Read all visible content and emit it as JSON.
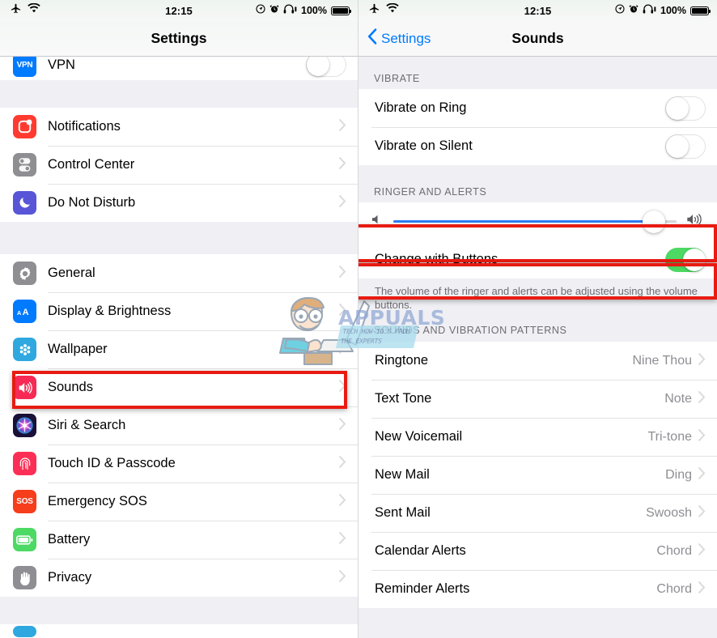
{
  "status_bar": {
    "airplane_icon": "airplane-icon",
    "wifi_icon": "wifi-icon",
    "time": "12:15",
    "location_icon": "location-icon",
    "alarm_icon": "alarm-icon",
    "headphones_icon": "headphones-icon",
    "battery_percent": "100%",
    "battery_icon": "battery-icon"
  },
  "left_screen": {
    "title": "Settings",
    "groups": [
      {
        "rows": [
          {
            "label": "VPN",
            "icon": "vpn-icon",
            "accessory": "toggle",
            "toggle_on": false,
            "icon_color": "#007aff"
          }
        ]
      },
      {
        "rows": [
          {
            "label": "Notifications",
            "icon": "notifications-icon",
            "accessory": "chevron",
            "icon_color": "#ff3b30"
          },
          {
            "label": "Control Center",
            "icon": "control-center-icon",
            "accessory": "chevron",
            "icon_color": "#8e8e93"
          },
          {
            "label": "Do Not Disturb",
            "icon": "do-not-disturb-icon",
            "accessory": "chevron",
            "icon_color": "#5856d6"
          }
        ]
      },
      {
        "rows": [
          {
            "label": "General",
            "icon": "gear-icon",
            "accessory": "chevron",
            "icon_color": "#8e8e93"
          },
          {
            "label": "Display & Brightness",
            "icon": "display-brightness-icon",
            "accessory": "chevron",
            "icon_color": "#007aff"
          },
          {
            "label": "Wallpaper",
            "icon": "wallpaper-icon",
            "accessory": "chevron",
            "icon_color": "#2fa8e0"
          },
          {
            "label": "Sounds",
            "icon": "sounds-icon",
            "accessory": "chevron",
            "icon_color": "#f62a54",
            "highlighted": true
          },
          {
            "label": "Siri & Search",
            "icon": "siri-icon",
            "accessory": "chevron",
            "icon_color": "#1b1038"
          },
          {
            "label": "Touch ID & Passcode",
            "icon": "touch-id-icon",
            "accessory": "chevron",
            "icon_color": "#fb2f55"
          },
          {
            "label": "Emergency SOS",
            "icon": "emergency-sos-icon",
            "accessory": "chevron",
            "icon_color": "#f63d1c"
          },
          {
            "label": "Battery",
            "icon": "battery-settings-icon",
            "accessory": "chevron",
            "icon_color": "#4cd964"
          },
          {
            "label": "Privacy",
            "icon": "privacy-icon",
            "accessory": "chevron",
            "icon_color": "#8e8e93"
          }
        ]
      }
    ]
  },
  "right_screen": {
    "back_label": "Settings",
    "title": "Sounds",
    "vibrate_header": "VIBRATE",
    "vibrate_rows": [
      {
        "label": "Vibrate on Ring",
        "toggle_on": false
      },
      {
        "label": "Vibrate on Silent",
        "toggle_on": false
      }
    ],
    "ringer_header": "RINGER AND ALERTS",
    "volume_slider": {
      "value": 92,
      "min_icon": "speaker-low-icon",
      "max_icon": "speaker-high-icon"
    },
    "change_with_buttons": {
      "label": "Change with Buttons",
      "toggle_on": true
    },
    "footer_text": "The volume of the ringer and alerts can be adjusted using the volume buttons.",
    "patterns_header": "SOUNDS AND VIBRATION PATTERNS",
    "pattern_rows": [
      {
        "label": "Ringtone",
        "value": "Nine Thou"
      },
      {
        "label": "Text Tone",
        "value": "Note"
      },
      {
        "label": "New Voicemail",
        "value": "Tri-tone"
      },
      {
        "label": "New Mail",
        "value": "Ding"
      },
      {
        "label": "Sent Mail",
        "value": "Swoosh"
      },
      {
        "label": "Calendar Alerts",
        "value": "Chord"
      },
      {
        "label": "Reminder Alerts",
        "value": "Chord"
      }
    ]
  },
  "watermark": {
    "brand": "APPUALS",
    "tagline_line1": "TECH HOW-TO'S FROM",
    "tagline_line2": "THE EXPERTS",
    "mascot": "mascot-illustration"
  },
  "colors": {
    "accent_blue": "#007aff",
    "slider_blue": "#2f7cf6",
    "toggle_green": "#4cd964",
    "highlight_red": "#e81b12",
    "group_bg": "#efeff4",
    "secondary_text": "#8e8e93"
  }
}
